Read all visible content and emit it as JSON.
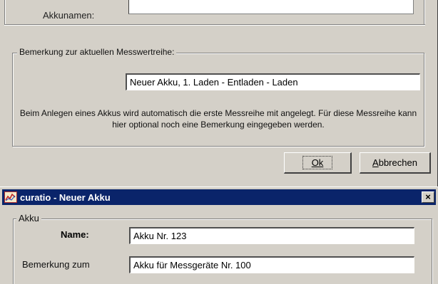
{
  "top_dialog": {
    "akkunamen_label": "Akkunamen:",
    "group_label": "Bemerkung zur aktuellen Messwertreihe:",
    "measure_remark_value": "Neuer Akku, 1. Laden - Entladen - Laden",
    "info_text": "Beim Anlegen eines Akkus wird automatisch die erste Messreihe mit angelegt. Für diese Messreihe kann hier optional noch eine Bemerkung eingegeben werden.",
    "ok_label": "Ok",
    "cancel_label": "Abbrechen"
  },
  "bottom_dialog": {
    "title": "curatio - Neuer Akku",
    "close_glyph": "×",
    "group_label": "Akku",
    "name_label": "Name:",
    "name_value": "Akku Nr. 123",
    "remark_label": "Bemerkung zum",
    "remark_value": "Akku für Messgeräte Nr. 100"
  },
  "colors": {
    "dialog_bg": "#d4d0c8",
    "titlebar_bg": "#0a246a",
    "input_bg": "#ffffff"
  },
  "icons": {
    "app_icon": "chart-icon",
    "close_icon": "close-icon"
  }
}
